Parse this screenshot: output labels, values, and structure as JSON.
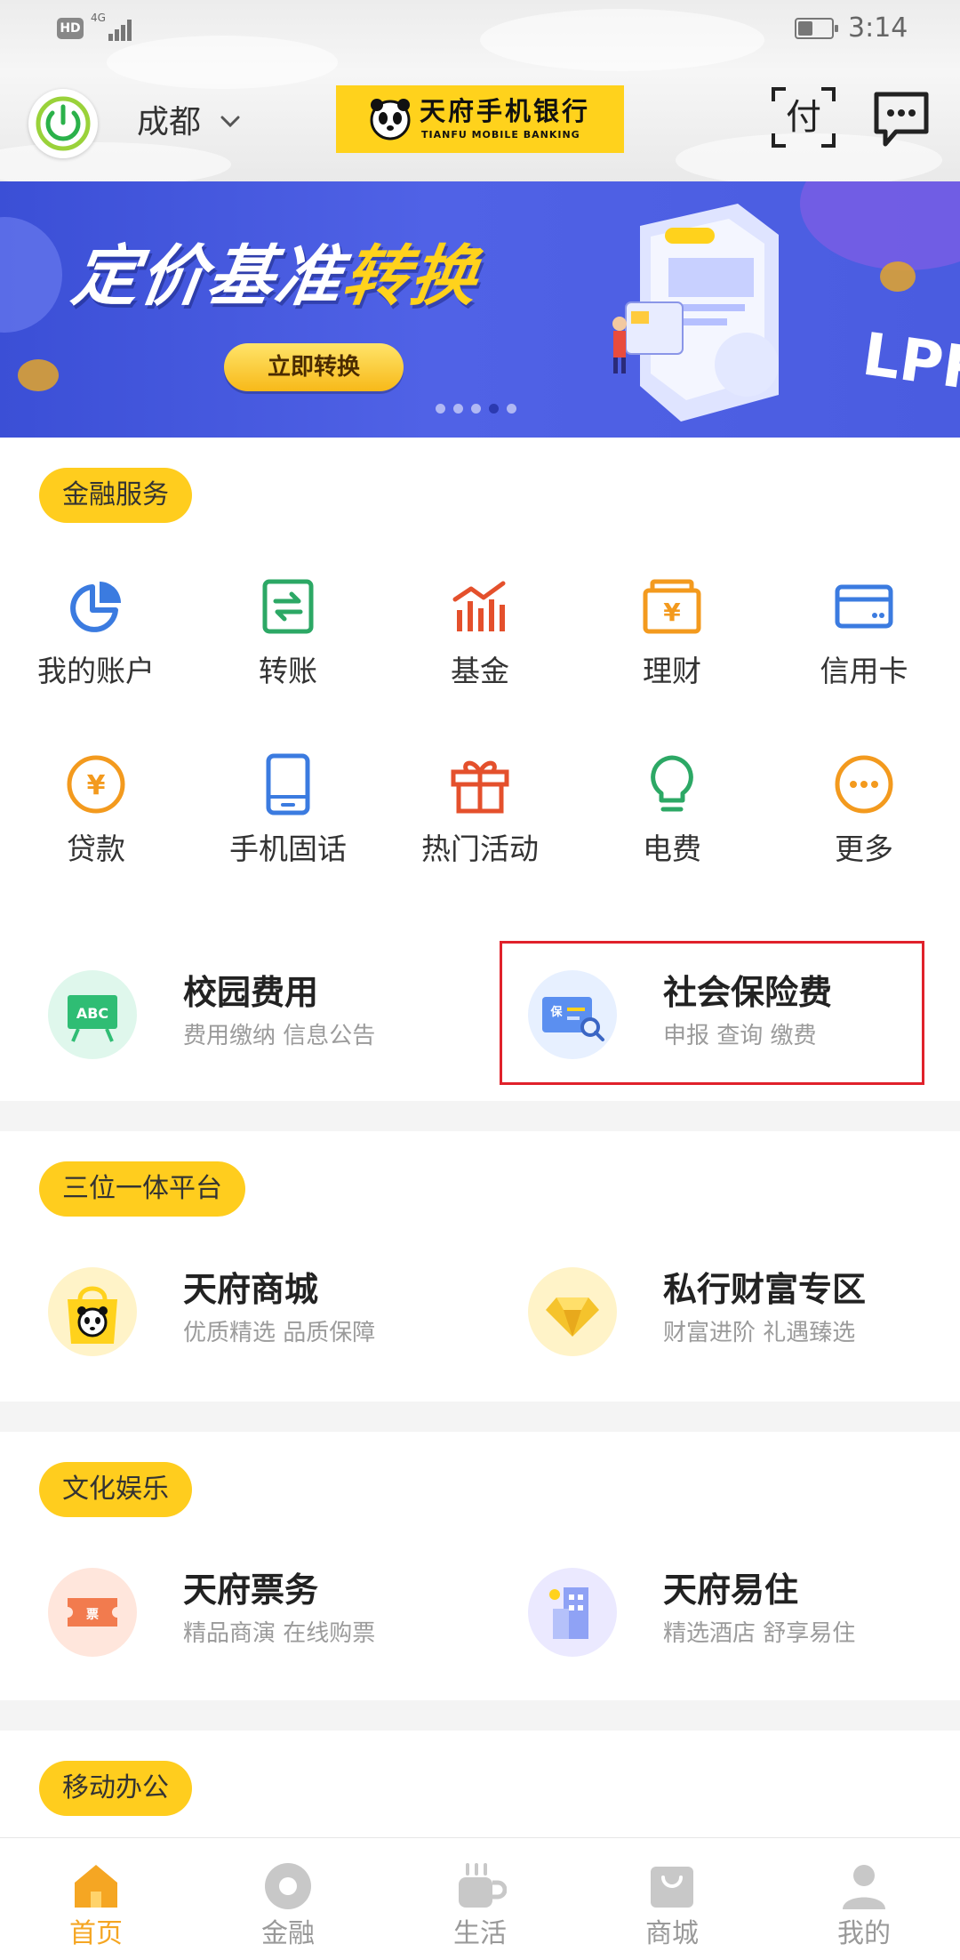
{
  "status_bar": {
    "hd": "HD",
    "network": "4G",
    "battery_level": 0.45,
    "time": "3:14"
  },
  "header": {
    "city": "成都",
    "logo_cn": "天府手机银行",
    "logo_en": "TIANFU MOBILE BANKING",
    "scan_pay_label": "付"
  },
  "banner": {
    "title_main": "定价基准",
    "title_highlight": "转换",
    "button_label": "立即转换",
    "art_text": "LPR",
    "slides": 5,
    "active_slide": 4
  },
  "financial_services": {
    "section_label": "金融服务",
    "items": [
      {
        "label": "我的账户",
        "icon": "pie-chart-icon",
        "color": "#3b7be0"
      },
      {
        "label": "转账",
        "icon": "transfer-icon",
        "color": "#2ca865"
      },
      {
        "label": "基金",
        "icon": "fund-chart-icon",
        "color": "#e4502c"
      },
      {
        "label": "理财",
        "icon": "wealth-yen-icon",
        "color": "#f39a1e"
      },
      {
        "label": "信用卡",
        "icon": "credit-card-icon",
        "color": "#3b7be0"
      },
      {
        "label": "贷款",
        "icon": "loan-yen-icon",
        "color": "#f39a1e"
      },
      {
        "label": "手机固话",
        "icon": "phone-icon",
        "color": "#3b7be0"
      },
      {
        "label": "热门活动",
        "icon": "gift-icon",
        "color": "#e4502c"
      },
      {
        "label": "电费",
        "icon": "lightbulb-icon",
        "color": "#2ca865"
      },
      {
        "label": "更多",
        "icon": "more-icon",
        "color": "#f39a1e"
      }
    ],
    "features": [
      {
        "title": "校园费用",
        "subtitle": "费用缴纳  信息公告",
        "icon": "abc-board-icon"
      },
      {
        "title": "社会保险费",
        "subtitle": "申报 查询 缴费",
        "icon": "insurance-card-icon"
      }
    ]
  },
  "platform": {
    "section_label": "三位一体平台",
    "features": [
      {
        "title": "天府商城",
        "subtitle": "优质精选 品质保障",
        "icon": "panda-bag-icon"
      },
      {
        "title": "私行财富专区",
        "subtitle": "财富进阶 礼遇臻选",
        "icon": "diamond-icon"
      }
    ]
  },
  "entertainment": {
    "section_label": "文化娱乐",
    "features": [
      {
        "title": "天府票务",
        "subtitle": "精品商演 在线购票",
        "icon": "ticket-icon"
      },
      {
        "title": "天府易住",
        "subtitle": "精选酒店 舒享易住",
        "icon": "hotel-icon"
      }
    ]
  },
  "office": {
    "section_label": "移动办公"
  },
  "tabbar": {
    "tabs": [
      {
        "label": "首页",
        "icon": "home-icon",
        "active": true
      },
      {
        "label": "金融",
        "icon": "coin-icon",
        "active": false
      },
      {
        "label": "生活",
        "icon": "coffee-cup-icon",
        "active": false
      },
      {
        "label": "商城",
        "icon": "shopping-bag-icon",
        "active": false
      },
      {
        "label": "我的",
        "icon": "user-icon",
        "active": false
      }
    ]
  },
  "colors": {
    "accent_yellow": "#ffcd1e",
    "active_tab": "#f5a623",
    "inactive_tab": "#999999",
    "banner_blue": "#4a5ce0",
    "highlight_red": "#e0212b"
  }
}
